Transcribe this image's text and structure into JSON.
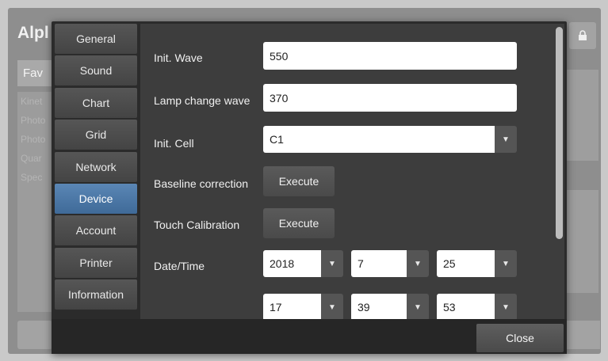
{
  "background": {
    "title": "Alpl",
    "fav_tab": "Fav",
    "list_items": [
      "Kinet",
      "Photo",
      "Photo",
      "Quar",
      "Spec"
    ],
    "icon": "lock-icon"
  },
  "tabs": [
    {
      "label": "General"
    },
    {
      "label": "Sound"
    },
    {
      "label": "Chart"
    },
    {
      "label": "Grid"
    },
    {
      "label": "Network"
    },
    {
      "label": "Device",
      "active": true
    },
    {
      "label": "Account"
    },
    {
      "label": "Printer"
    },
    {
      "label": "Information"
    }
  ],
  "device": {
    "init_wave": {
      "label": "Init. Wave",
      "value": "550"
    },
    "lamp_change_wave": {
      "label": "Lamp change wave",
      "value": "370"
    },
    "init_cell": {
      "label": "Init. Cell",
      "value": "C1"
    },
    "baseline": {
      "label": "Baseline correction",
      "button": "Execute"
    },
    "touch": {
      "label": "Touch Calibration",
      "button": "Execute"
    },
    "datetime": {
      "label": "Date/Time",
      "year": "2018",
      "month": "7",
      "day": "25",
      "hour": "17",
      "minute": "39",
      "second": "53"
    }
  },
  "footer": {
    "close_label": "Close"
  },
  "colors": {
    "active_tab": "#4a76a6",
    "modal_bg": "#2b2b2b",
    "content_bg": "#3d3d3d"
  }
}
